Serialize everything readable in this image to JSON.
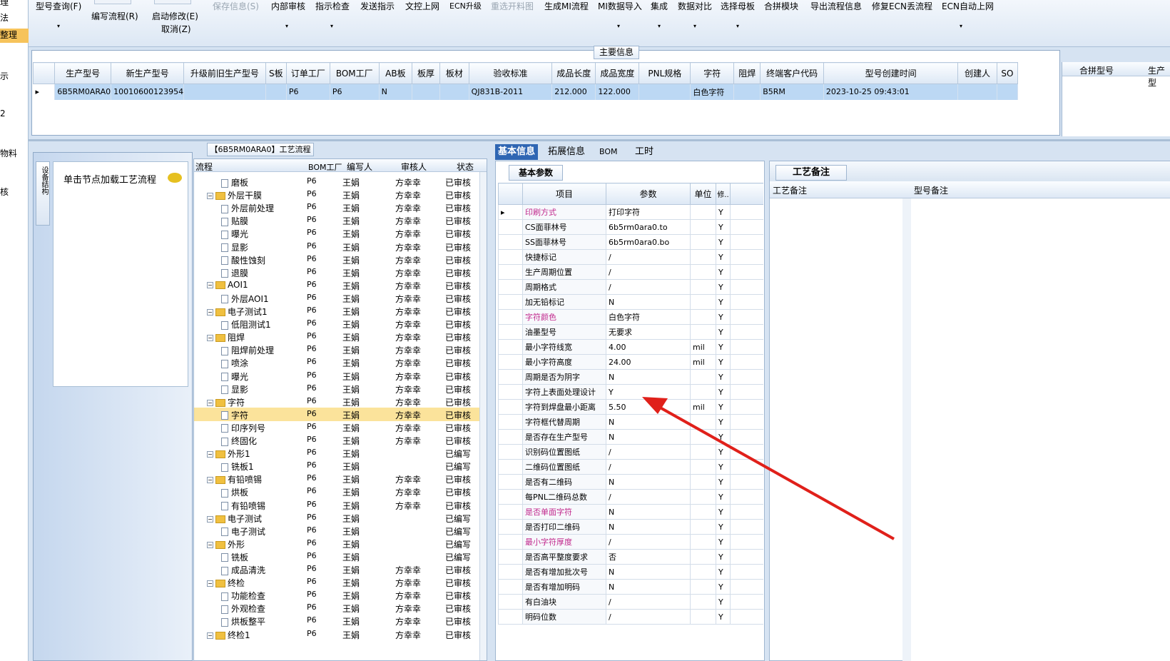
{
  "left_nav": [
    "理",
    "法",
    "整理",
    "示",
    "2",
    "物料",
    "核"
  ],
  "toolbar": {
    "model_query": "型号查询(F)",
    "write_flow": "编写流程(R)",
    "start_modify": "启动修改(E)",
    "cancel": "取消(Z)",
    "save_info": "保存信息(S)",
    "internal_review": "内部审核",
    "guide_check": "指示检查",
    "send_guide": "发送指示",
    "docs_online": "文控上网",
    "ecn_upgrade": "ECN升级",
    "reselect_diagram": "重选开料图",
    "gen_mi_flow": "生成MI流程",
    "mi_import": "MI数据导入",
    "integrate": "集成",
    "data_compare": "数据对比",
    "select_mother": "选择母板",
    "merge_module": "合拼模块",
    "export_flow": "导出流程信息",
    "fix_ecn": "修复ECN丢流程",
    "ecn_auto_online": "ECN自动上网"
  },
  "main_info": {
    "title": "主要信息",
    "columns": [
      "生产型号",
      "新生产型号",
      "升级前旧生产型号",
      "S板",
      "订单工厂",
      "BOM工厂",
      "AB板",
      "板厚",
      "板材",
      "验收标准",
      "成品长度",
      "成品宽度",
      "PNL规格",
      "字符",
      "阻焊",
      "终端客户代码",
      "型号创建时间",
      "创建人",
      "SO"
    ],
    "row": [
      "6B5RM0ARA0",
      "10010600123954",
      "",
      "",
      "P6",
      "P6",
      "N",
      "",
      "",
      "QJ831B-2011",
      "212.000",
      "122.000",
      "",
      "白色字符",
      "",
      "B5RM",
      "2023-10-25 09:43:01",
      "",
      ""
    ]
  },
  "merge": {
    "col1": "合拼型号",
    "col2": "生产型"
  },
  "flow_panel": {
    "title": "【6B5RM0ARA0】工艺流程",
    "hint": "单击节点加载工艺流程",
    "side_tab": "设备结构"
  },
  "tree": {
    "headers": [
      "流程",
      "BOM工厂",
      "编写人",
      "审核人",
      "状态"
    ],
    "rows": [
      {
        "t": "doc",
        "lvl": 2,
        "name": "磨板",
        "c": "P6",
        "w": "王娟",
        "r": "方幸幸",
        "s": "已审核"
      },
      {
        "t": "fold",
        "lvl": 1,
        "name": "外层干膜",
        "c": "P6",
        "w": "王娟",
        "r": "方幸幸",
        "s": "已审核"
      },
      {
        "t": "doc",
        "lvl": 2,
        "name": "外层前处理",
        "c": "P6",
        "w": "王娟",
        "r": "方幸幸",
        "s": "已审核"
      },
      {
        "t": "doc",
        "lvl": 2,
        "name": "贴膜",
        "c": "P6",
        "w": "王娟",
        "r": "方幸幸",
        "s": "已审核"
      },
      {
        "t": "doc",
        "lvl": 2,
        "name": "曝光",
        "c": "P6",
        "w": "王娟",
        "r": "方幸幸",
        "s": "已审核"
      },
      {
        "t": "doc",
        "lvl": 2,
        "name": "显影",
        "c": "P6",
        "w": "王娟",
        "r": "方幸幸",
        "s": "已审核"
      },
      {
        "t": "doc",
        "lvl": 2,
        "name": "酸性蚀刻",
        "c": "P6",
        "w": "王娟",
        "r": "方幸幸",
        "s": "已审核"
      },
      {
        "t": "doc",
        "lvl": 2,
        "name": "退膜",
        "c": "P6",
        "w": "王娟",
        "r": "方幸幸",
        "s": "已审核"
      },
      {
        "t": "fold",
        "lvl": 1,
        "name": "AOI1",
        "c": "P6",
        "w": "王娟",
        "r": "方幸幸",
        "s": "已审核"
      },
      {
        "t": "doc",
        "lvl": 2,
        "name": "外层AOI1",
        "c": "P6",
        "w": "王娟",
        "r": "方幸幸",
        "s": "已审核"
      },
      {
        "t": "fold",
        "lvl": 1,
        "name": "电子测试1",
        "c": "P6",
        "w": "王娟",
        "r": "方幸幸",
        "s": "已审核"
      },
      {
        "t": "doc",
        "lvl": 2,
        "name": "低阻测试1",
        "c": "P6",
        "w": "王娟",
        "r": "方幸幸",
        "s": "已审核"
      },
      {
        "t": "fold",
        "lvl": 1,
        "name": "阻焊",
        "c": "P6",
        "w": "王娟",
        "r": "方幸幸",
        "s": "已审核"
      },
      {
        "t": "doc",
        "lvl": 2,
        "name": "阻焊前处理",
        "c": "P6",
        "w": "王娟",
        "r": "方幸幸",
        "s": "已审核"
      },
      {
        "t": "doc",
        "lvl": 2,
        "name": "喷涂",
        "c": "P6",
        "w": "王娟",
        "r": "方幸幸",
        "s": "已审核"
      },
      {
        "t": "doc",
        "lvl": 2,
        "name": "曝光",
        "c": "P6",
        "w": "王娟",
        "r": "方幸幸",
        "s": "已审核"
      },
      {
        "t": "doc",
        "lvl": 2,
        "name": "显影",
        "c": "P6",
        "w": "王娟",
        "r": "方幸幸",
        "s": "已审核"
      },
      {
        "t": "fold",
        "lvl": 1,
        "name": "字符",
        "c": "P6",
        "w": "王娟",
        "r": "方幸幸",
        "s": "已审核"
      },
      {
        "t": "doc",
        "lvl": 2,
        "name": "字符",
        "c": "P6",
        "w": "王娟",
        "r": "方幸幸",
        "s": "已审核",
        "hl": true
      },
      {
        "t": "doc",
        "lvl": 2,
        "name": "印序列号",
        "c": "P6",
        "w": "王娟",
        "r": "方幸幸",
        "s": "已审核"
      },
      {
        "t": "doc",
        "lvl": 2,
        "name": "终固化",
        "c": "P6",
        "w": "王娟",
        "r": "方幸幸",
        "s": "已审核"
      },
      {
        "t": "fold",
        "lvl": 1,
        "name": "外形1",
        "c": "P6",
        "w": "王娟",
        "r": "",
        "s": "已编写"
      },
      {
        "t": "doc",
        "lvl": 2,
        "name": "铣板1",
        "c": "P6",
        "w": "王娟",
        "r": "",
        "s": "已编写"
      },
      {
        "t": "fold",
        "lvl": 1,
        "name": "有铅喷锡",
        "c": "P6",
        "w": "王娟",
        "r": "方幸幸",
        "s": "已审核"
      },
      {
        "t": "doc",
        "lvl": 2,
        "name": "烘板",
        "c": "P6",
        "w": "王娟",
        "r": "方幸幸",
        "s": "已审核"
      },
      {
        "t": "doc",
        "lvl": 2,
        "name": "有铅喷锡",
        "c": "P6",
        "w": "王娟",
        "r": "方幸幸",
        "s": "已审核"
      },
      {
        "t": "fold",
        "lvl": 1,
        "name": "电子测试",
        "c": "P6",
        "w": "王娟",
        "r": "",
        "s": "已编写"
      },
      {
        "t": "doc",
        "lvl": 2,
        "name": "电子测试",
        "c": "P6",
        "w": "王娟",
        "r": "",
        "s": "已编写"
      },
      {
        "t": "fold",
        "lvl": 1,
        "name": "外形",
        "c": "P6",
        "w": "王娟",
        "r": "",
        "s": "已编写"
      },
      {
        "t": "doc",
        "lvl": 2,
        "name": "铣板",
        "c": "P6",
        "w": "王娟",
        "r": "",
        "s": "已编写"
      },
      {
        "t": "doc",
        "lvl": 2,
        "name": "成品清洗",
        "c": "P6",
        "w": "王娟",
        "r": "方幸幸",
        "s": "已审核"
      },
      {
        "t": "fold",
        "lvl": 1,
        "name": "终检",
        "c": "P6",
        "w": "王娟",
        "r": "方幸幸",
        "s": "已审核"
      },
      {
        "t": "doc",
        "lvl": 2,
        "name": "功能检查",
        "c": "P6",
        "w": "王娟",
        "r": "方幸幸",
        "s": "已审核"
      },
      {
        "t": "doc",
        "lvl": 2,
        "name": "外观检查",
        "c": "P6",
        "w": "王娟",
        "r": "方幸幸",
        "s": "已审核"
      },
      {
        "t": "doc",
        "lvl": 2,
        "name": "烘板整平",
        "c": "P6",
        "w": "王娟",
        "r": "方幸幸",
        "s": "已审核"
      },
      {
        "t": "fold",
        "lvl": 1,
        "name": "终检1",
        "c": "P6",
        "w": "王娟",
        "r": "方幸幸",
        "s": "已审核"
      }
    ]
  },
  "tabs": [
    "基本信息",
    "拓展信息",
    "BOM",
    "工时"
  ],
  "basic": {
    "caption": "基本参数",
    "headers": [
      "项目",
      "参数",
      "单位",
      "修.."
    ]
  },
  "params": [
    {
      "k": "印刷方式",
      "v": "打印字符",
      "u": "",
      "m": "Y",
      "mag": true
    },
    {
      "k": "CS面菲林号",
      "v": "6b5rm0ara0.to",
      "u": "",
      "m": "Y"
    },
    {
      "k": "SS面菲林号",
      "v": "6b5rm0ara0.bo",
      "u": "",
      "m": "Y"
    },
    {
      "k": "快捷标记",
      "v": "/",
      "u": "",
      "m": "Y"
    },
    {
      "k": "生产周期位置",
      "v": "/",
      "u": "",
      "m": "Y"
    },
    {
      "k": "周期格式",
      "v": "/",
      "u": "",
      "m": "Y"
    },
    {
      "k": "加无铅标记",
      "v": "N",
      "u": "",
      "m": "Y"
    },
    {
      "k": "字符颜色",
      "v": "白色字符",
      "u": "",
      "m": "Y",
      "mag": true
    },
    {
      "k": "油墨型号",
      "v": "无要求",
      "u": "",
      "m": "Y"
    },
    {
      "k": "最小字符线宽",
      "v": "4.00",
      "u": "mil",
      "m": "Y"
    },
    {
      "k": "最小字符高度",
      "v": "24.00",
      "u": "mil",
      "m": "Y"
    },
    {
      "k": "周期是否为阴字",
      "v": "N",
      "u": "",
      "m": "Y"
    },
    {
      "k": "字符上表面处理设计",
      "v": "Y",
      "u": "",
      "m": "Y"
    },
    {
      "k": "字符到焊盘最小距离",
      "v": "5.50",
      "u": "mil",
      "m": "Y"
    },
    {
      "k": "字符框代替周期",
      "v": "N",
      "u": "",
      "m": "Y"
    },
    {
      "k": "是否存在生产型号",
      "v": "N",
      "u": "",
      "m": "Y"
    },
    {
      "k": "识别码位置图纸",
      "v": "/",
      "u": "",
      "m": "Y"
    },
    {
      "k": "二维码位置图纸",
      "v": "/",
      "u": "",
      "m": "Y"
    },
    {
      "k": "是否有二维码",
      "v": "N",
      "u": "",
      "m": "Y"
    },
    {
      "k": "每PNL二维码总数",
      "v": "/",
      "u": "",
      "m": "Y"
    },
    {
      "k": "是否单面字符",
      "v": "N",
      "u": "",
      "m": "Y",
      "mag": true
    },
    {
      "k": "是否打印二维码",
      "v": "N",
      "u": "",
      "m": "Y"
    },
    {
      "k": "最小字符厚度",
      "v": "/",
      "u": "",
      "m": "Y",
      "mag": true
    },
    {
      "k": "是否高平整度要求",
      "v": "否",
      "u": "",
      "m": "Y"
    },
    {
      "k": "是否有增加批次号",
      "v": "N",
      "u": "",
      "m": "Y"
    },
    {
      "k": "是否有增加明码",
      "v": "N",
      "u": "",
      "m": "Y"
    },
    {
      "k": "有白油块",
      "v": "/",
      "u": "",
      "m": "Y"
    },
    {
      "k": "明码位数",
      "v": "/",
      "u": "",
      "m": "Y"
    }
  ],
  "notes": {
    "caption": "工艺备注",
    "col1": "工艺备注",
    "col2": "型号备注"
  },
  "colors": {
    "accent": "#2f66b3",
    "highlight": "#fbe39b",
    "row_select": "#bcd8f4",
    "arrow": "#e0201a",
    "magenta": "#c0288c"
  }
}
